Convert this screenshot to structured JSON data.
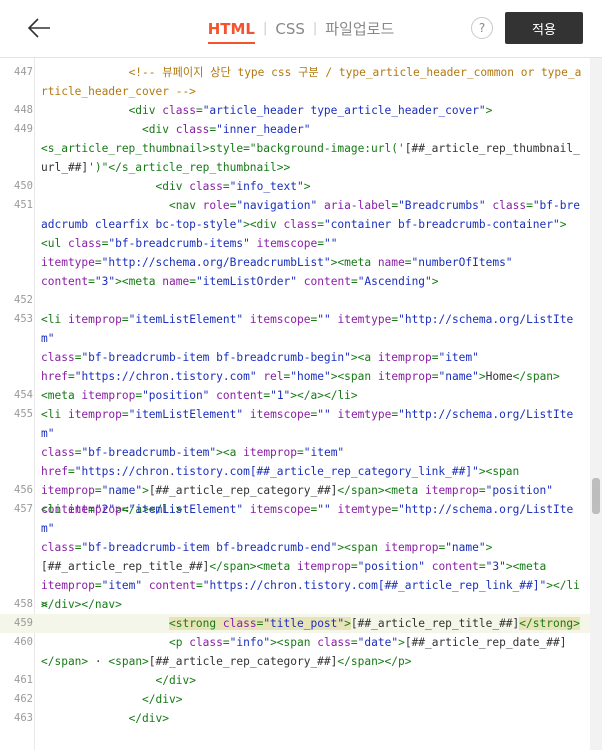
{
  "header": {
    "tabs": [
      {
        "label": "HTML",
        "active": true
      },
      {
        "label": "CSS",
        "active": false
      },
      {
        "label": "파일업로드",
        "active": false
      }
    ],
    "help_label": "?",
    "apply_label": "적용",
    "accent_color": "#f5532d"
  },
  "editor": {
    "lines": [
      {
        "n": "447",
        "indent": 13,
        "tokens": [
          [
            "c",
            "<!-- 뷰페이지 상단 type css 구분 / type_article_header_common or type_article_header_cover -->"
          ]
        ]
      },
      {
        "n": "448",
        "indent": 13,
        "tokens": [
          [
            "t",
            "<div "
          ],
          [
            "a",
            "class"
          ],
          [
            "t",
            "="
          ],
          [
            "s",
            "\"article_header type_article_header_cover\""
          ],
          [
            "t",
            ">"
          ]
        ]
      },
      {
        "n": "449",
        "indent": 15,
        "tokens": [
          [
            "t",
            "<div "
          ],
          [
            "a",
            "class"
          ],
          [
            "t",
            "="
          ],
          [
            "s",
            "\"inner_header\""
          ],
          [
            "t",
            "\n<s_article_rep_thumbnail>style=\"background-image:url('"
          ],
          [
            "x",
            "[##_article_rep_thumbnail_url_##]"
          ],
          [
            "t",
            "')\"</s_article_rep_thumbnail>>"
          ]
        ]
      },
      {
        "n": "450",
        "indent": 17,
        "tokens": [
          [
            "t",
            "<div "
          ],
          [
            "a",
            "class"
          ],
          [
            "t",
            "="
          ],
          [
            "s",
            "\"info_text\""
          ],
          [
            "t",
            ">"
          ]
        ]
      },
      {
        "n": "451",
        "indent": 19,
        "tokens": [
          [
            "t",
            "<nav "
          ],
          [
            "a",
            "role"
          ],
          [
            "t",
            "="
          ],
          [
            "s",
            "\"navigation\""
          ],
          [
            "x",
            " "
          ],
          [
            "a",
            "aria-label"
          ],
          [
            "t",
            "="
          ],
          [
            "s",
            "\"Breadcrumbs\""
          ],
          [
            "x",
            " "
          ],
          [
            "a",
            "class"
          ],
          [
            "t",
            "="
          ],
          [
            "s",
            "\"bf-breadcrumb clearfix bc-top-style\""
          ],
          [
            "t",
            "><div "
          ],
          [
            "a",
            "class"
          ],
          [
            "t",
            "="
          ],
          [
            "s",
            "\"container bf-breadcrumb-container\""
          ],
          [
            "t",
            ">\n<ul "
          ],
          [
            "a",
            "class"
          ],
          [
            "t",
            "="
          ],
          [
            "s",
            "\"bf-breadcrumb-items\""
          ],
          [
            "x",
            " "
          ],
          [
            "a",
            "itemscope"
          ],
          [
            "t",
            "="
          ],
          [
            "s",
            "\"\""
          ],
          [
            "x",
            "\n"
          ],
          [
            "a",
            "itemtype"
          ],
          [
            "t",
            "="
          ],
          [
            "s",
            "\"http://schema.org/BreadcrumbList\""
          ],
          [
            "t",
            "><meta "
          ],
          [
            "a",
            "name"
          ],
          [
            "t",
            "="
          ],
          [
            "s",
            "\"numberOfItems\""
          ],
          [
            "x",
            "\n"
          ],
          [
            "a",
            "content"
          ],
          [
            "t",
            "="
          ],
          [
            "s",
            "\"3\""
          ],
          [
            "t",
            "><meta "
          ],
          [
            "a",
            "name"
          ],
          [
            "t",
            "="
          ],
          [
            "s",
            "\"itemListOrder\""
          ],
          [
            "x",
            " "
          ],
          [
            "a",
            "content"
          ],
          [
            "t",
            "="
          ],
          [
            "s",
            "\"Ascending\""
          ],
          [
            "t",
            ">"
          ]
        ]
      },
      {
        "n": "452",
        "indent": 0,
        "tokens": []
      },
      {
        "n": "453",
        "indent": 0,
        "tokens": [
          [
            "t",
            "<li "
          ],
          [
            "a",
            "itemprop"
          ],
          [
            "t",
            "="
          ],
          [
            "s",
            "\"itemListElement\""
          ],
          [
            "x",
            " "
          ],
          [
            "a",
            "itemscope"
          ],
          [
            "t",
            "="
          ],
          [
            "s",
            "\"\""
          ],
          [
            "x",
            " "
          ],
          [
            "a",
            "itemtype"
          ],
          [
            "t",
            "="
          ],
          [
            "s",
            "\"http://schema.org/ListItem\""
          ],
          [
            "x",
            "\n"
          ],
          [
            "a",
            "class"
          ],
          [
            "t",
            "="
          ],
          [
            "s",
            "\"bf-breadcrumb-item bf-breadcrumb-begin\""
          ],
          [
            "t",
            "><a "
          ],
          [
            "a",
            "itemprop"
          ],
          [
            "t",
            "="
          ],
          [
            "s",
            "\"item\""
          ],
          [
            "x",
            "\n"
          ],
          [
            "a",
            "href"
          ],
          [
            "t",
            "="
          ],
          [
            "s",
            "\"https://chron.tistory.com\""
          ],
          [
            "x",
            " "
          ],
          [
            "a",
            "rel"
          ],
          [
            "t",
            "="
          ],
          [
            "s",
            "\"home\""
          ],
          [
            "t",
            "><span "
          ],
          [
            "a",
            "itemprop"
          ],
          [
            "t",
            "="
          ],
          [
            "s",
            "\"name\""
          ],
          [
            "t",
            ">"
          ],
          [
            "x",
            "Home"
          ],
          [
            "t",
            "</span>\n<meta "
          ],
          [
            "a",
            "itemprop"
          ],
          [
            "t",
            "="
          ],
          [
            "s",
            "\"position\""
          ],
          [
            "x",
            " "
          ],
          [
            "a",
            "content"
          ],
          [
            "t",
            "="
          ],
          [
            "s",
            "\"1\""
          ],
          [
            "t",
            "></a></li>"
          ]
        ]
      },
      {
        "n": "454",
        "indent": 0,
        "tokens": []
      },
      {
        "n": "455",
        "indent": 0,
        "tokens": [
          [
            "t",
            "<li "
          ],
          [
            "a",
            "itemprop"
          ],
          [
            "t",
            "="
          ],
          [
            "s",
            "\"itemListElement\""
          ],
          [
            "x",
            " "
          ],
          [
            "a",
            "itemscope"
          ],
          [
            "t",
            "="
          ],
          [
            "s",
            "\"\""
          ],
          [
            "x",
            " "
          ],
          [
            "a",
            "itemtype"
          ],
          [
            "t",
            "="
          ],
          [
            "s",
            "\"http://schema.org/ListItem\""
          ],
          [
            "x",
            "\n"
          ],
          [
            "a",
            "class"
          ],
          [
            "t",
            "="
          ],
          [
            "s",
            "\"bf-breadcrumb-item\""
          ],
          [
            "t",
            "><a "
          ],
          [
            "a",
            "itemprop"
          ],
          [
            "t",
            "="
          ],
          [
            "s",
            "\"item\""
          ],
          [
            "x",
            "\n"
          ],
          [
            "a",
            "href"
          ],
          [
            "t",
            "="
          ],
          [
            "s",
            "\"https://chron.tistory.com[##_article_rep_category_link_##]\""
          ],
          [
            "t",
            "><span\n"
          ],
          [
            "a",
            "itemprop"
          ],
          [
            "t",
            "="
          ],
          [
            "s",
            "\"name\""
          ],
          [
            "t",
            ">"
          ],
          [
            "x",
            "[##_article_rep_category_##]"
          ],
          [
            "t",
            "</span><meta "
          ],
          [
            "a",
            "itemprop"
          ],
          [
            "t",
            "="
          ],
          [
            "s",
            "\"position\""
          ],
          [
            "x",
            "\n"
          ],
          [
            "a",
            "content"
          ],
          [
            "t",
            "="
          ],
          [
            "s",
            "\"2\""
          ],
          [
            "t",
            "></a></li>"
          ]
        ]
      },
      {
        "n": "456",
        "indent": 0,
        "tokens": []
      },
      {
        "n": "457",
        "indent": 0,
        "tokens": [
          [
            "t",
            "<li "
          ],
          [
            "a",
            "itemprop"
          ],
          [
            "t",
            "="
          ],
          [
            "s",
            "\"itemListElement\""
          ],
          [
            "x",
            " "
          ],
          [
            "a",
            "itemscope"
          ],
          [
            "t",
            "="
          ],
          [
            "s",
            "\"\""
          ],
          [
            "x",
            " "
          ],
          [
            "a",
            "itemtype"
          ],
          [
            "t",
            "="
          ],
          [
            "s",
            "\"http://schema.org/ListItem\""
          ],
          [
            "x",
            "\n"
          ],
          [
            "a",
            "class"
          ],
          [
            "t",
            "="
          ],
          [
            "s",
            "\"bf-breadcrumb-item bf-breadcrumb-end\""
          ],
          [
            "t",
            "><span "
          ],
          [
            "a",
            "itemprop"
          ],
          [
            "t",
            "="
          ],
          [
            "s",
            "\"name\""
          ],
          [
            "t",
            ">\n"
          ],
          [
            "x",
            "[##_article_rep_title_##]"
          ],
          [
            "t",
            "</span><meta "
          ],
          [
            "a",
            "itemprop"
          ],
          [
            "t",
            "="
          ],
          [
            "s",
            "\"position\""
          ],
          [
            "x",
            " "
          ],
          [
            "a",
            "content"
          ],
          [
            "t",
            "="
          ],
          [
            "s",
            "\"3\""
          ],
          [
            "t",
            "><meta\n"
          ],
          [
            "a",
            "itemprop"
          ],
          [
            "t",
            "="
          ],
          [
            "s",
            "\"item\""
          ],
          [
            "x",
            " "
          ],
          [
            "a",
            "content"
          ],
          [
            "t",
            "="
          ],
          [
            "s",
            "\"https://chron.tistory.com[##_article_rep_link_##]\""
          ],
          [
            "t",
            "></li>\n</ul>"
          ]
        ]
      },
      {
        "n": "458",
        "indent": 0,
        "tokens": [
          [
            "t",
            "</div></nav>"
          ]
        ]
      },
      {
        "n": "459",
        "indent": 19,
        "highlight": true,
        "tokens": [
          [
            "th",
            "<strong "
          ],
          [
            "ah",
            "class"
          ],
          [
            "th",
            "="
          ],
          [
            "sh",
            "\"title_post\""
          ],
          [
            "th",
            ">"
          ],
          [
            "x",
            "[##_article_rep_title_##]"
          ],
          [
            "th",
            "</strong>"
          ]
        ]
      },
      {
        "n": "460",
        "indent": 19,
        "tokens": [
          [
            "t",
            "<p "
          ],
          [
            "a",
            "class"
          ],
          [
            "t",
            "="
          ],
          [
            "s",
            "\"info\""
          ],
          [
            "t",
            "><span "
          ],
          [
            "a",
            "class"
          ],
          [
            "t",
            "="
          ],
          [
            "s",
            "\"date\""
          ],
          [
            "t",
            ">"
          ],
          [
            "x",
            "[##_article_rep_date_##]\n"
          ],
          [
            "t",
            "</span>"
          ],
          [
            "x",
            " · "
          ],
          [
            "t",
            "<span>"
          ],
          [
            "x",
            "[##_article_rep_category_##]"
          ],
          [
            "t",
            "</span></p>"
          ]
        ]
      },
      {
        "n": "461",
        "indent": 17,
        "tokens": [
          [
            "t",
            "</div>"
          ]
        ]
      },
      {
        "n": "462",
        "indent": 15,
        "tokens": [
          [
            "t",
            "</div>"
          ]
        ]
      },
      {
        "n": "463",
        "indent": 13,
        "tokens": [
          [
            "t",
            "</div>"
          ]
        ]
      }
    ]
  }
}
